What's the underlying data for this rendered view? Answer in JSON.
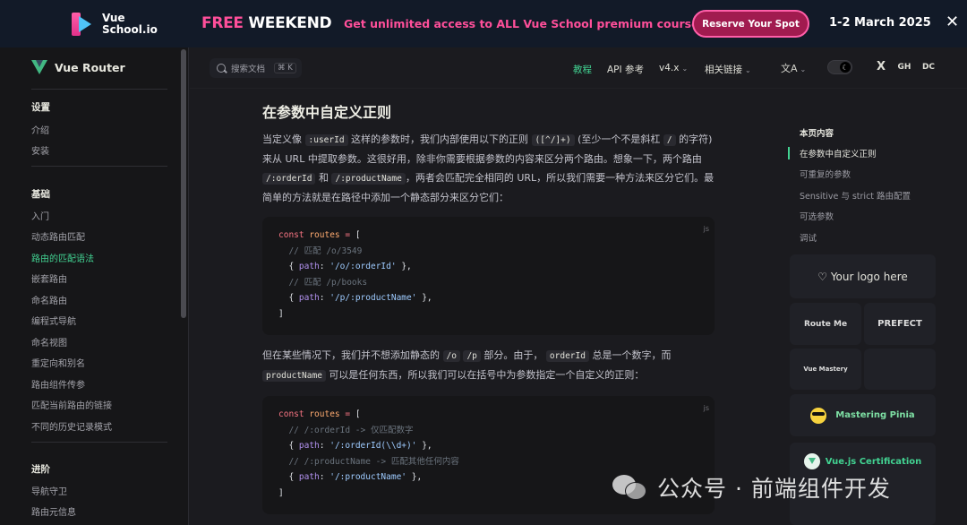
{
  "banner": {
    "logo_line1": "Vue",
    "logo_line2": "School.io",
    "free": "FREE",
    "weekend": "WEEKEND",
    "message": "Get unlimited access to ALL Vue School premium courses",
    "cta": "Reserve Your Spot",
    "date": "1-2 March 2025",
    "close": "✕"
  },
  "sidebar": {
    "title": "Vue Router",
    "groups": [
      {
        "label": "设置",
        "items": [
          "介绍",
          "安装"
        ]
      },
      {
        "label": "基础",
        "items": [
          "入门",
          "动态路由匹配",
          "路由的匹配语法",
          "嵌套路由",
          "命名路由",
          "编程式导航",
          "命名视图",
          "重定向和别名",
          "路由组件传参",
          "匹配当前路由的链接",
          "不同的历史记录模式"
        ]
      },
      {
        "label": "进阶",
        "items": [
          "导航守卫",
          "路由元信息"
        ]
      }
    ],
    "active_item": "路由的匹配语法"
  },
  "topnav": {
    "search_placeholder": "搜索文档",
    "search_shortcut": "⌘ K",
    "links": [
      "教程",
      "API 参考",
      "v4.x",
      "相关链接"
    ],
    "active_link": "教程",
    "translate_icon": "文A",
    "social": [
      "X",
      "GH",
      "DC"
    ]
  },
  "main": {
    "heading": "在参数中自定义正则",
    "para1": {
      "t1": "当定义像",
      "c1": ":userId",
      "t2": "这样的参数时，我们内部使用以下的正则",
      "c2": "([^/]+)",
      "t3": "(至少一个不是斜杠",
      "c3": "/",
      "t4": "的字符)来从 URL 中提取参数。这很好用，除非你需要根据参数的内容来区分两个路由。想象一下，两个路由",
      "c4": "/:orderId",
      "t5": "和",
      "c5": "/:productName",
      "t6": "，两者会匹配完全相同的 URL，所以我们需要一种方法来区分它们。最简单的方法就是在路径中添加一个静态部分来区分它们："
    },
    "code1": {
      "lang": "js",
      "lines": [
        [
          [
            "kw",
            "const "
          ],
          [
            "var",
            "routes"
          ],
          [
            "kw",
            " = "
          ],
          [
            "txt",
            "["
          ]
        ],
        [
          [
            "cm",
            "  // 匹配 /o/3549"
          ]
        ],
        [
          [
            "txt",
            "  { "
          ],
          [
            "prop",
            "path"
          ],
          [
            "txt",
            ": "
          ],
          [
            "str",
            "'/o/:orderId'"
          ],
          [
            "txt",
            " },"
          ]
        ],
        [
          [
            "cm",
            "  // 匹配 /p/books"
          ]
        ],
        [
          [
            "txt",
            "  { "
          ],
          [
            "prop",
            "path"
          ],
          [
            "txt",
            ": "
          ],
          [
            "str",
            "'/p/:productName'"
          ],
          [
            "txt",
            " },"
          ]
        ],
        [
          [
            "txt",
            "]"
          ]
        ]
      ]
    },
    "para2": {
      "t1": "但在某些情况下，我们并不想添加静态的",
      "c1": "/o",
      "c2": "/p",
      "t2": "部分。由于，",
      "c3": "orderId",
      "t3": "总是一个数字，而",
      "c4": "productName",
      "t4": "可以是任何东西，所以我们可以在括号中为参数指定一个自定义的正则："
    },
    "code2": {
      "lang": "js",
      "lines": [
        [
          [
            "kw",
            "const "
          ],
          [
            "var",
            "routes"
          ],
          [
            "kw",
            " = "
          ],
          [
            "txt",
            "["
          ]
        ],
        [
          [
            "cm",
            "  // /:orderId -> 仅匹配数字"
          ]
        ],
        [
          [
            "txt",
            "  { "
          ],
          [
            "prop",
            "path"
          ],
          [
            "txt",
            ": "
          ],
          [
            "str",
            "'/:orderId(\\\\d+)'"
          ],
          [
            "txt",
            " },"
          ]
        ],
        [
          [
            "cm",
            "  // /:productName -> 匹配其他任何内容"
          ]
        ],
        [
          [
            "txt",
            "  { "
          ],
          [
            "prop",
            "path"
          ],
          [
            "txt",
            ": "
          ],
          [
            "str",
            "'/:productName'"
          ],
          [
            "txt",
            " },"
          ]
        ],
        [
          [
            "txt",
            "]"
          ]
        ]
      ]
    }
  },
  "aside": {
    "title": "本页内容",
    "items": [
      "在参数中自定义正则",
      "可重复的参数",
      "Sensitive 与 strict 路由配置",
      "可选参数",
      "调试"
    ],
    "active_item": "在参数中自定义正则",
    "sponsors": {
      "logo_here": "♡ Your logo here",
      "routeme": "Route Me",
      "prefect": "PREFECT",
      "vuemastery": "Vue Mastery",
      "pinia": "Mastering Pinia",
      "cert": "Vue.js Certification"
    }
  },
  "watermark": "公众号 · 前端组件开发",
  "colors": {
    "accent": "#42d392",
    "banner_pink": "#ff4f9a",
    "bg": "#1b1b1f"
  }
}
